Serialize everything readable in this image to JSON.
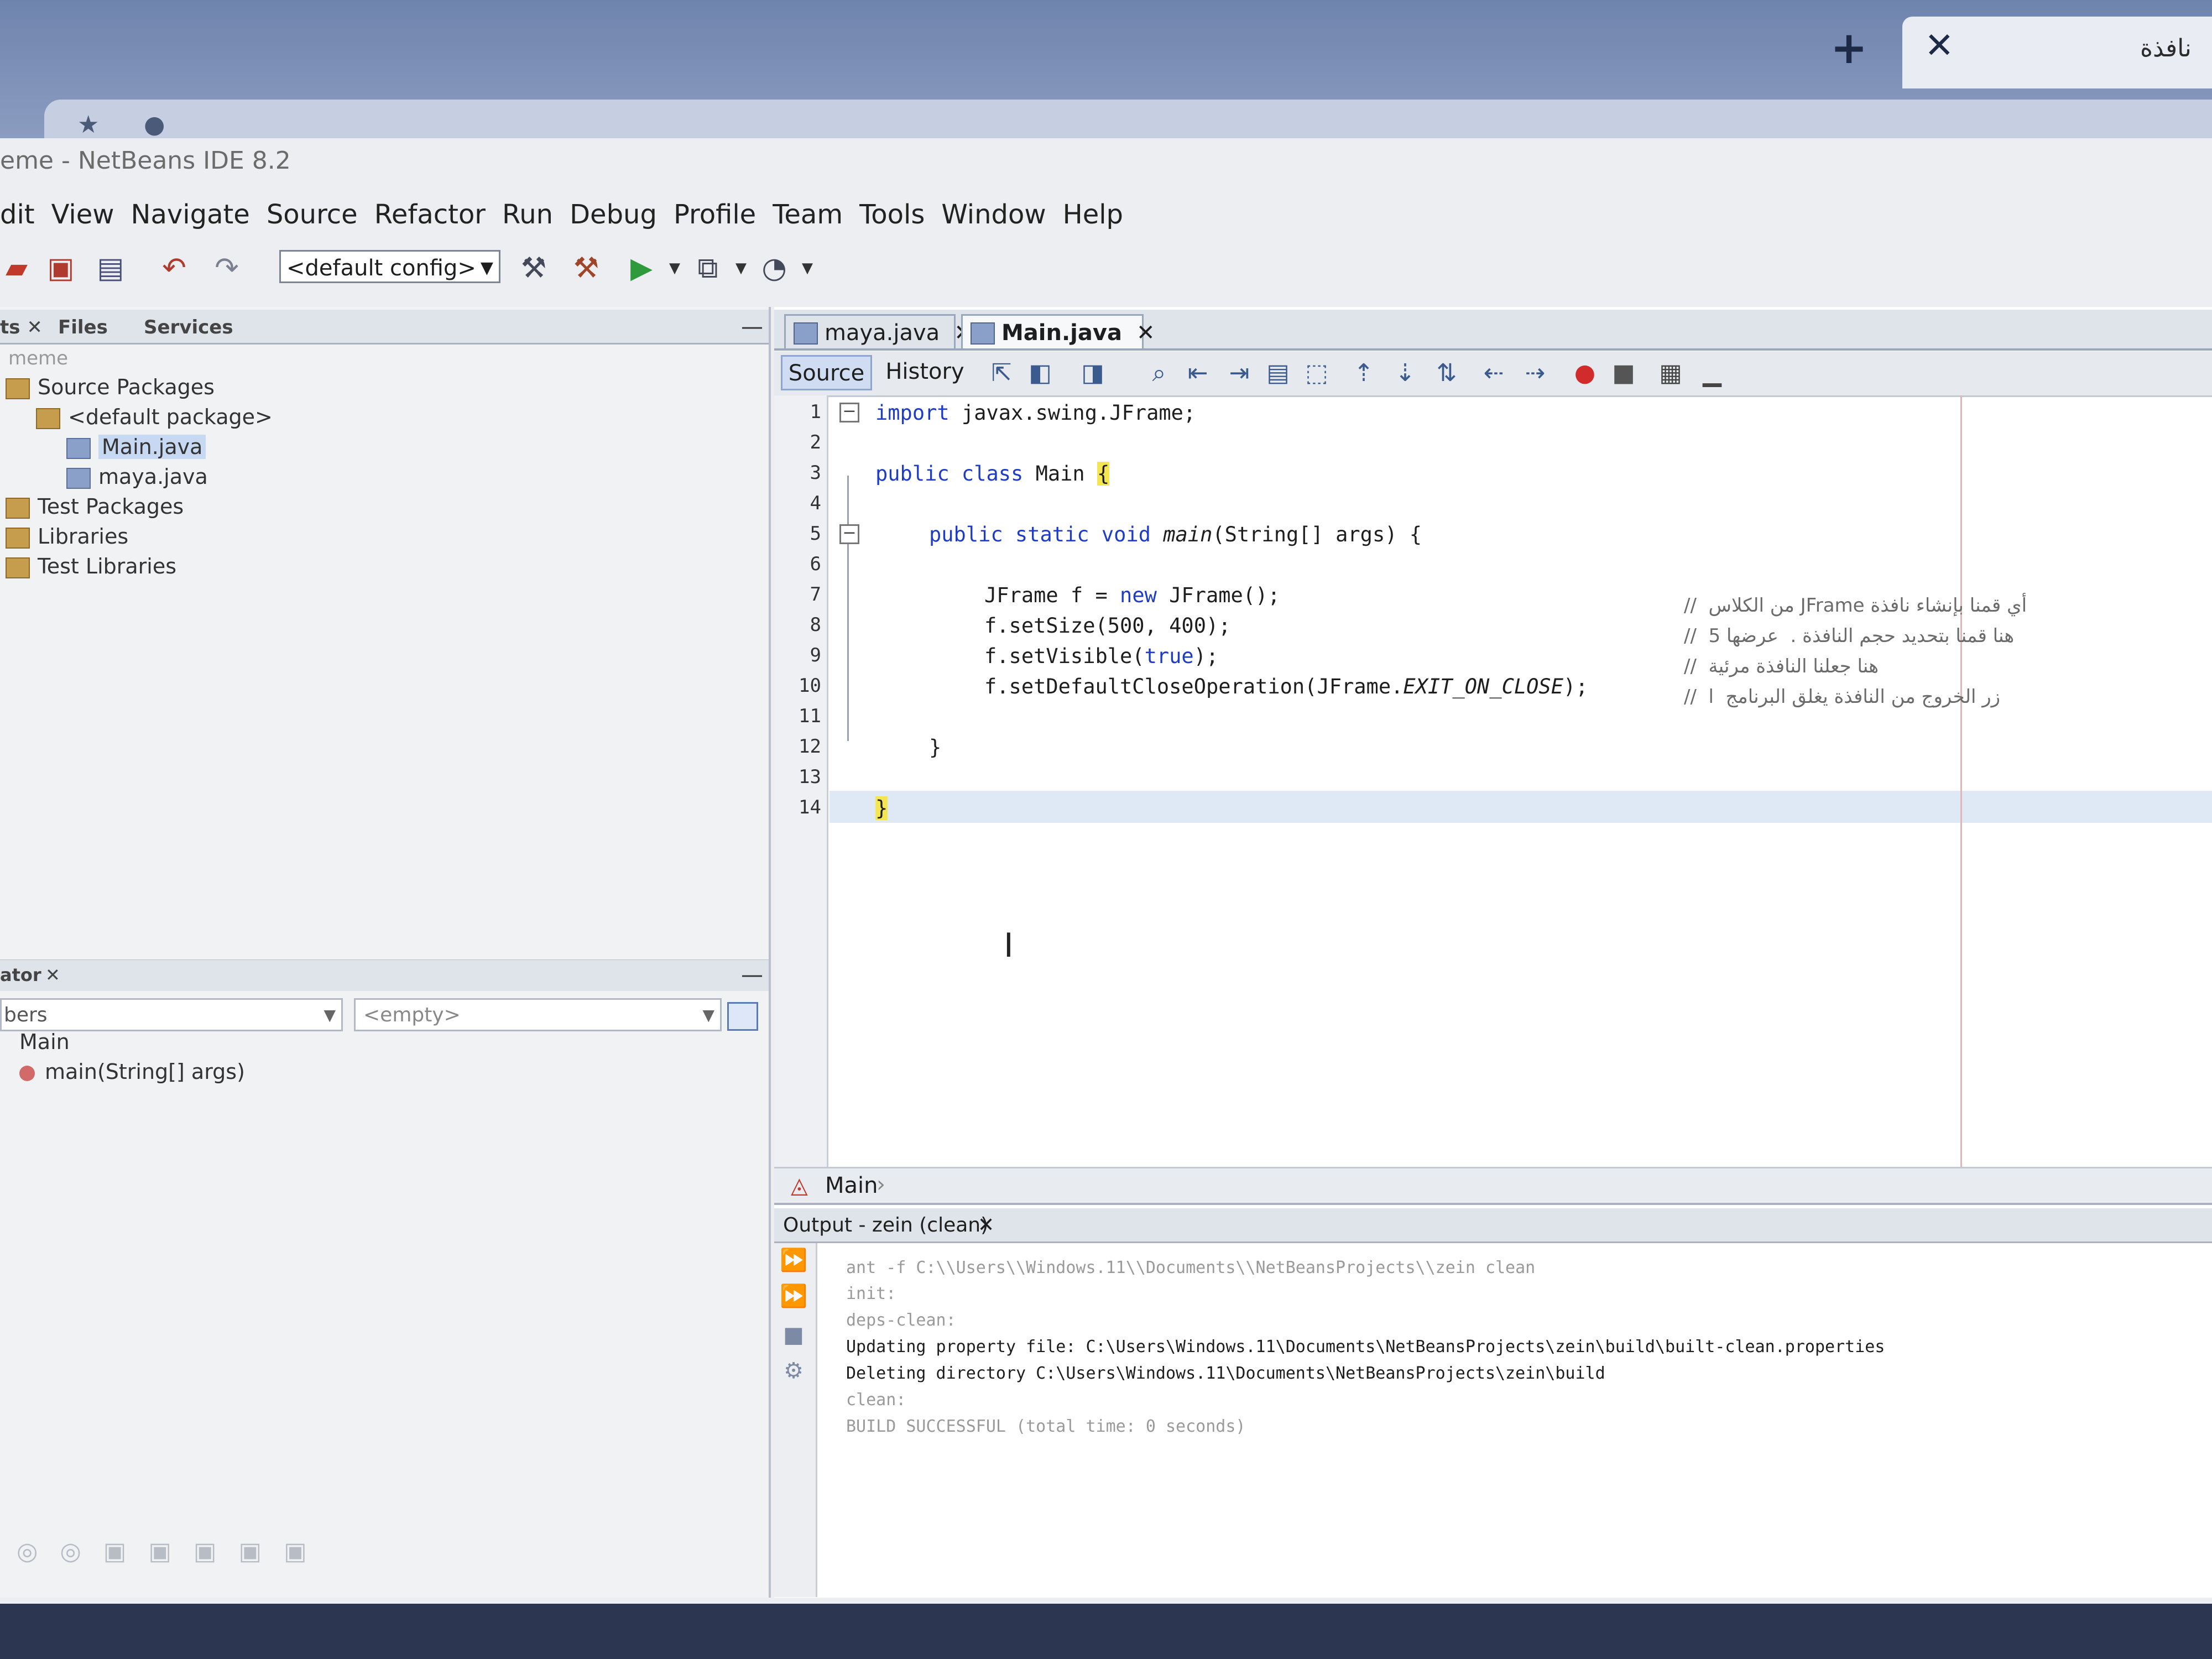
{
  "browser": {
    "new_tab": "+",
    "close_tab": "✕",
    "tab_title": "نافذة"
  },
  "window": {
    "title": "eme - NetBeans IDE 8.2"
  },
  "menu": [
    "dit",
    "View",
    "Navigate",
    "Source",
    "Refactor",
    "Run",
    "Debug",
    "Profile",
    "Team",
    "Tools",
    "Window",
    "Help"
  ],
  "toolbar": {
    "config": "<default config>"
  },
  "projects": {
    "tabs": [
      "ts ✕",
      "Files",
      "Services"
    ],
    "minimize": "—",
    "root": "meme",
    "tree": [
      {
        "label": "Source Packages",
        "indent": 0,
        "icon": "package-folder-icon"
      },
      {
        "label": "<default package>",
        "indent": 1,
        "icon": "package-icon"
      },
      {
        "label": "Main.java",
        "indent": 2,
        "icon": "java-file-icon",
        "selected": true
      },
      {
        "label": "maya.java",
        "indent": 2,
        "icon": "java-file-icon"
      },
      {
        "label": "Test Packages",
        "indent": 0,
        "icon": "package-folder-icon"
      },
      {
        "label": "Libraries",
        "indent": 0,
        "icon": "library-icon"
      },
      {
        "label": "Test Libraries",
        "indent": 0,
        "icon": "library-icon"
      }
    ]
  },
  "navigator": {
    "tab": "ator",
    "tab_close": "✕",
    "minimize": "—",
    "members": "bers",
    "filter": "<empty>",
    "items": [
      {
        "label": "Main"
      },
      {
        "label": "main(String[] args)"
      }
    ]
  },
  "editor": {
    "tabs": [
      {
        "label": "maya.java",
        "close": "✕",
        "active": false
      },
      {
        "label": "Main.java",
        "close": "✕",
        "active": true
      }
    ],
    "source_label": "Source",
    "history_label": "History",
    "line_numbers": [
      "1",
      "2",
      "3",
      "4",
      "5",
      "6",
      "7",
      "8",
      "9",
      "10",
      "11",
      "12",
      "13",
      "14"
    ],
    "code": {
      "l1_kw": "import",
      "l1_rest": " javax.swing.JFrame;",
      "l3_kw": "public class",
      "l3_rest": " Main ",
      "l3_brace": "{",
      "l5_kw": "public static void",
      "l5_name": " main",
      "l5_rest": "(String[] args) {",
      "l7_a": "JFrame f = ",
      "l7_kw": "new",
      "l7_b": " JFrame();",
      "l8": "f.setSize(500, 400);",
      "l9_a": "f.setVisible(",
      "l9_kw": "true",
      "l9_b": ");",
      "l10_a": "f.setDefaultCloseOperation(JFrame.",
      "l10_it": "EXIT_ON_CLOSE",
      "l10_b": ");",
      "l12": "}",
      "l14": "}"
    },
    "comments": {
      "c7": "//  من الكلاس JFrame أي قمنا بإنشاء نافذة",
      "c8": "//  هنا قمنا بتحديد حجم النافذة .  عرضها 5",
      "c9": "//  هنا جعلنا النافذة مرئية",
      "c10": "//  زر الخروج من النافذة يغلق البرنامج  ا"
    },
    "breadcrumb": "Main"
  },
  "output": {
    "title": "Output - zein (clean)",
    "close": "✕",
    "lines": [
      {
        "text": "ant -f C:\\\\Users\\\\Windows.11\\\\Documents\\\\NetBeansProjects\\\\zein clean",
        "dim": true
      },
      {
        "text": "init:",
        "dim": true
      },
      {
        "text": "deps-clean:",
        "dim": true
      },
      {
        "text": "Updating property file: C:\\Users\\Windows.11\\Documents\\NetBeansProjects\\zein\\build\\built-clean.properties",
        "dim": false
      },
      {
        "text": "Deleting directory C:\\Users\\Windows.11\\Documents\\NetBeansProjects\\zein\\build",
        "dim": false
      },
      {
        "text": "clean:",
        "dim": true
      },
      {
        "text": "BUILD SUCCESSFUL (total time: 0 seconds)",
        "dim": true
      }
    ]
  },
  "colors": {
    "keyword": "#1f3cc4",
    "brace_highlight": "#f4e552",
    "current_line": "#dfe9f5"
  }
}
